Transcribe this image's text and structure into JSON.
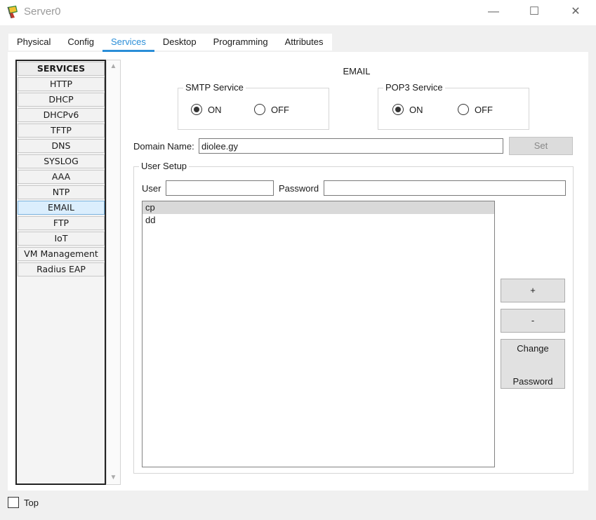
{
  "window": {
    "title": "Server0"
  },
  "tabs": [
    "Physical",
    "Config",
    "Services",
    "Desktop",
    "Programming",
    "Attributes"
  ],
  "services": {
    "header": "SERVICES",
    "items": [
      "HTTP",
      "DHCP",
      "DHCPv6",
      "TFTP",
      "DNS",
      "SYSLOG",
      "AAA",
      "NTP",
      "EMAIL",
      "FTP",
      "IoT",
      "VM Management",
      "Radius EAP"
    ],
    "selected": "EMAIL"
  },
  "email": {
    "title": "EMAIL",
    "smtp": {
      "label": "SMTP Service",
      "on_label": "ON",
      "off_label": "OFF",
      "value": "ON"
    },
    "pop3": {
      "label": "POP3 Service",
      "on_label": "ON",
      "off_label": "OFF",
      "value": "ON"
    },
    "domain": {
      "label": "Domain Name:",
      "value": "diolee.gy",
      "set_label": "Set"
    },
    "user_setup": {
      "label": "User Setup",
      "user_label": "User",
      "user_value": "",
      "password_label": "Password",
      "password_value": "",
      "users": [
        "cp",
        "dd"
      ],
      "selected_user": "cp",
      "add_label": "+",
      "remove_label": "-",
      "change_label_line1": "Change",
      "change_label_line2": "Password"
    }
  },
  "footer": {
    "top_label": "Top",
    "top_checked": false
  },
  "colors": {
    "accent": "#2a8ed8",
    "selected_item": "#dbeefd"
  }
}
